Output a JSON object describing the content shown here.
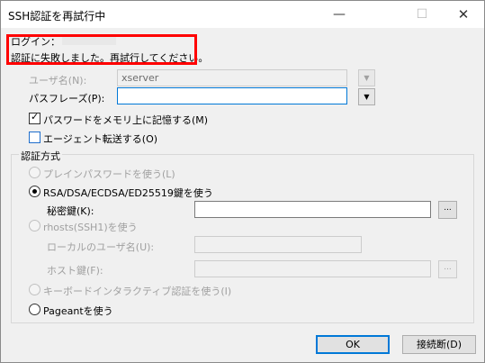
{
  "window": {
    "title": "SSH認証を再試行中",
    "minimize_glyph": "—",
    "maximize_glyph": "☐",
    "close_glyph": "✕"
  },
  "prompt": {
    "login_label": "ログイン：",
    "message": "認証に失敗しました。再試行してください。"
  },
  "username": {
    "label": "ユーザ名(N):",
    "value": "xserver"
  },
  "passphrase": {
    "label": "パスフレーズ(P):",
    "value": ""
  },
  "remember_password": {
    "label": "パスワードをメモリ上に記憶する(M)",
    "checked": true
  },
  "agent_forwarding": {
    "label": "エージェント転送する(O)",
    "checked": false
  },
  "auth_group": {
    "title": "認証方式",
    "plain_password": "プレインパスワードを使う(L)",
    "rsa_option": "RSA/DSA/ECDSA/ED25519鍵を使う",
    "private_key_label": "秘密鍵(K):",
    "private_key_value": "",
    "rhosts_option": "rhosts(SSH1)を使う",
    "local_user_label": "ローカルのユーザ名(U):",
    "host_key_label": "ホスト鍵(F):",
    "kbd_interactive": "キーボードインタラクティブ認証を使う(I)",
    "pageant": "Pageantを使う",
    "selected": "rsa_option"
  },
  "browse_label": "...",
  "buttons": {
    "ok": "OK",
    "disconnect": "接続断(D)"
  },
  "colors": {
    "highlight": "#ff0000",
    "default_button_border": "#0078d7"
  }
}
